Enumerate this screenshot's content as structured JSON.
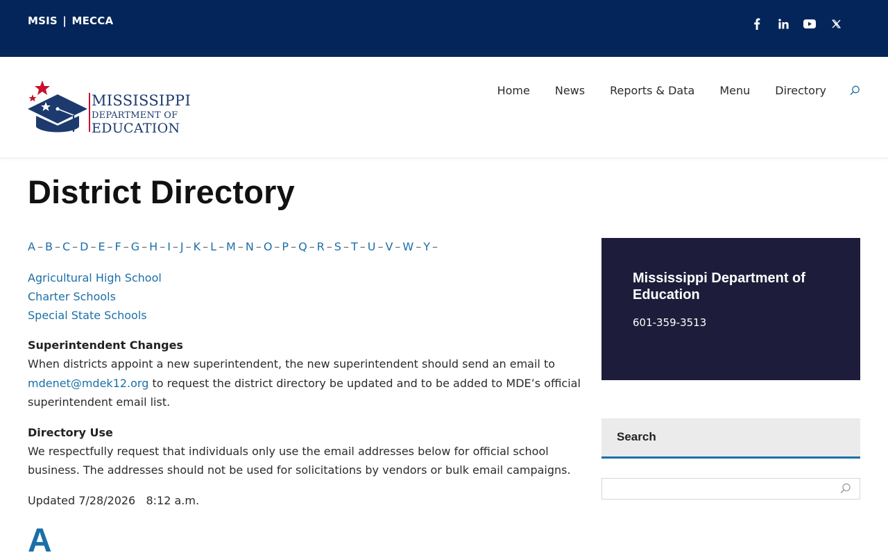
{
  "topbar": {
    "link1": "MSIS",
    "separator": "|",
    "link2": "MECCA",
    "social": [
      "facebook-icon",
      "linkedin-icon",
      "youtube-icon",
      "x-icon"
    ]
  },
  "logo": {
    "line1": "MISSISSIPPI",
    "line2": "DEPARTMENT OF",
    "line3": "EDUCATION"
  },
  "nav": {
    "items": [
      "Home",
      "News",
      "Reports & Data",
      "Menu",
      "Directory"
    ]
  },
  "page": {
    "title": "District Directory"
  },
  "alphabet": [
    "A",
    "B",
    "C",
    "D",
    "E",
    "F",
    "G",
    "H",
    "I",
    "J",
    "K",
    "L",
    "M",
    "N",
    "O",
    "P",
    "Q",
    "R",
    "S",
    "T",
    "U",
    "V",
    "W",
    "Y"
  ],
  "quick_links": [
    "Agricultural High School",
    "Charter Schools",
    "Special State Schools"
  ],
  "superintendent": {
    "heading": "Superintendent Changes",
    "text1": "When districts appoint a new superintendent, the new superintendent should send an email to",
    "email": "mdenet@mdek12.org",
    "text2": " to request the district directory be updated and to be added to MDE’s official superintendent email list."
  },
  "directory_use": {
    "heading": "Directory Use",
    "text": "We respectfully request that individuals only use the email addresses below for official school business. The addresses should not be used for solicitations by vendors or bulk email campaigns."
  },
  "updated": "Updated 7/28/2026   8:12 a.m.",
  "section_letter": "A",
  "contact": {
    "title": "Mississippi Department of Education",
    "phone": "601-359-3513"
  },
  "search_widget": {
    "title": "Search",
    "placeholder": ""
  },
  "colors": {
    "topbar": "#04255a",
    "link": "#1a6fa8",
    "card": "#1d1d3b",
    "accent_red": "#c8102e"
  }
}
